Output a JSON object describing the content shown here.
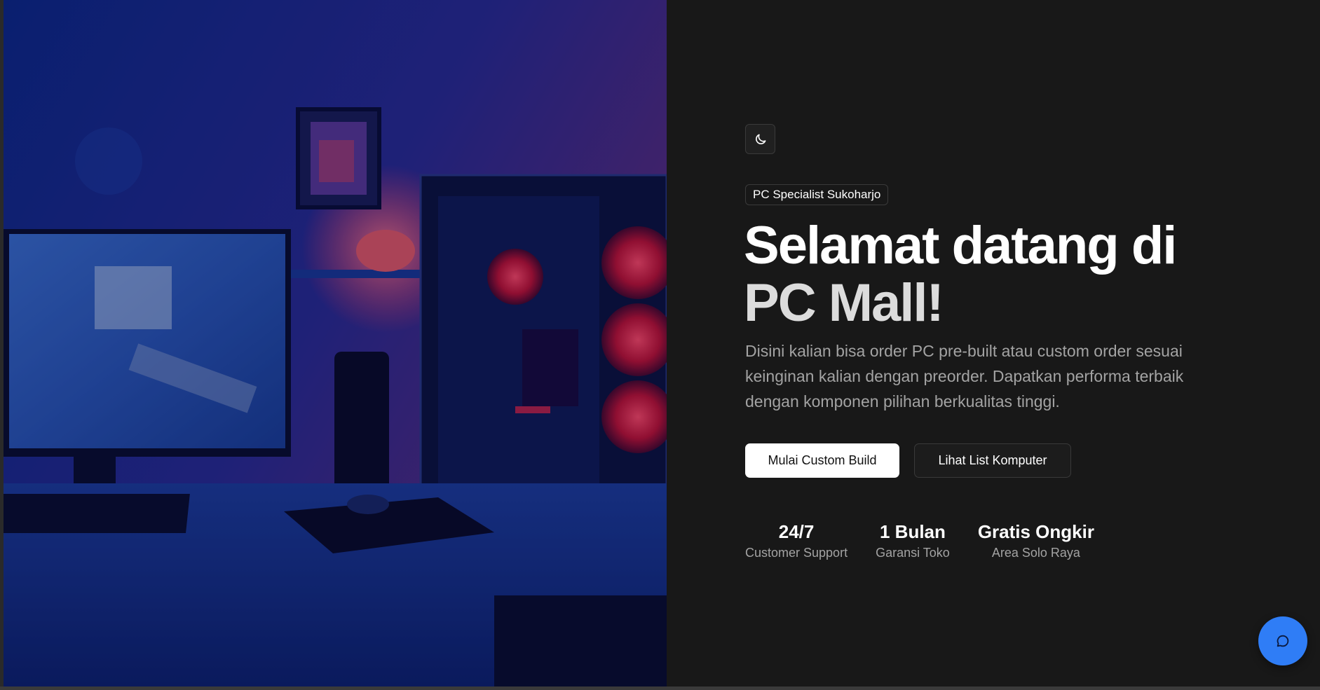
{
  "hero": {
    "image_alt": "Gaming PC setup with monitor and RGB case"
  },
  "theme_toggle": {
    "icon": "moon-icon"
  },
  "badge": "PC Specialist Sukoharjo",
  "headline": {
    "line1": "Selamat datang di",
    "line2": "PC Mall!"
  },
  "description": "Disini kalian bisa order PC pre-built atau custom order sesuai keinginan kalian dengan preorder. Dapatkan performa terbaik dengan komponen pilihan berkualitas tinggi.",
  "buttons": {
    "primary_label": "Mulai Custom Build",
    "secondary_label": "Lihat List Komputer"
  },
  "stats": [
    {
      "value": "24/7",
      "label": "Customer Support"
    },
    {
      "value": "1 Bulan",
      "label": "Garansi Toko"
    },
    {
      "value": "Gratis Ongkir",
      "label": "Area Solo Raya"
    }
  ],
  "chat": {
    "icon": "chat-bubble-icon"
  },
  "colors": {
    "background": "#181818",
    "accent": "#2f7df6",
    "text_primary": "#ffffff",
    "text_muted": "#a3a3a3"
  }
}
